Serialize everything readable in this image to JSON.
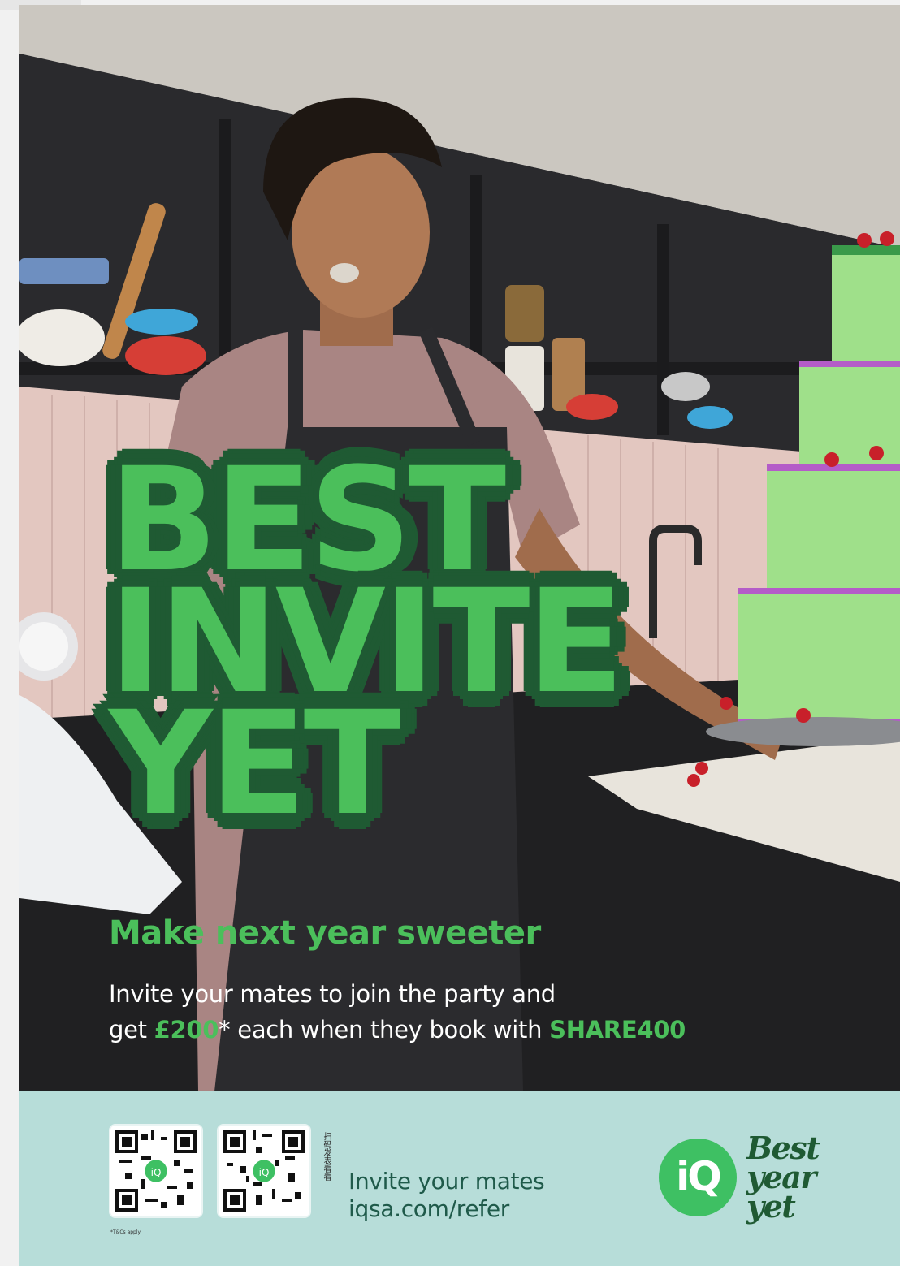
{
  "headline": {
    "line1": "BEST",
    "line2": "INVITE",
    "line3": "YET"
  },
  "subhead": "Make next year sweeter",
  "body": {
    "line1": "Invite your mates to join the party and",
    "line2_prefix": "get ",
    "amount": "£200",
    "asterisk": "*",
    "line2_middle": " each when they book with ",
    "code": "SHARE400"
  },
  "footer": {
    "scan_text": "扫码发表看看",
    "tcs": "*T&Cs apply",
    "invite_label": "Invite your mates",
    "url": "iqsa.com/refer",
    "logo_text": "iQ",
    "tagline": {
      "line1": "Best",
      "line2": "year",
      "line3": "yet"
    }
  },
  "colors": {
    "brand_green": "#4bbf5b",
    "dark_green": "#1f5a33",
    "footer_bg": "#b7ddd9"
  },
  "icons": [
    "qr-code-icon",
    "qr-code-icon",
    "iq-logo-icon"
  ]
}
